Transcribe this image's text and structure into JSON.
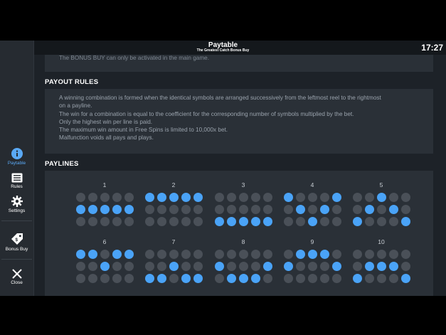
{
  "header": {
    "title": "Paytable",
    "subtitle": "The Greatest Catch Bonus Buy",
    "clock": "17:27"
  },
  "sidebar": {
    "items": [
      {
        "label": "Paytable",
        "icon": "info-icon",
        "active": true
      },
      {
        "label": "Rules",
        "icon": "list-icon"
      },
      {
        "label": "Settings",
        "icon": "gear-icon"
      },
      {
        "label": "Bonus Buy",
        "icon": "tag-icon"
      },
      {
        "label": "Close",
        "icon": "close-icon"
      }
    ]
  },
  "bonus_note": "The BONUS BUY can only be activated in the main game.",
  "payout": {
    "heading": "PAYOUT RULES",
    "lines": [
      "A winning combination is formed when the identical symbols are arranged successively from the leftmost reel to the rightmost",
      "on a payline.",
      "The win for a combination is equal to the coefficient for the corresponding number of symbols multiplied by the bet.",
      "Only the highest win per line is paid.",
      "The maximum win amount in Free Spins is limited to 10,000x bet.",
      "Malfunction voids all pays and plays."
    ]
  },
  "paylines": {
    "heading": "PAYLINES",
    "active_color": "#4aa3f7",
    "inactive_color": "#4a5058",
    "items": [
      {
        "number": "1",
        "rows": [
          1,
          1,
          1,
          1,
          1
        ]
      },
      {
        "number": "2",
        "rows": [
          0,
          0,
          0,
          0,
          0
        ]
      },
      {
        "number": "3",
        "rows": [
          2,
          2,
          2,
          2,
          2
        ]
      },
      {
        "number": "4",
        "rows": [
          0,
          1,
          2,
          1,
          0
        ]
      },
      {
        "number": "5",
        "rows": [
          2,
          1,
          0,
          1,
          2
        ]
      },
      {
        "number": "6",
        "rows": [
          0,
          0,
          1,
          0,
          0
        ]
      },
      {
        "number": "7",
        "rows": [
          2,
          2,
          1,
          2,
          2
        ]
      },
      {
        "number": "8",
        "rows": [
          1,
          2,
          2,
          2,
          1
        ]
      },
      {
        "number": "9",
        "rows": [
          1,
          0,
          0,
          0,
          1
        ]
      },
      {
        "number": "10",
        "rows": [
          2,
          1,
          1,
          1,
          2
        ]
      }
    ]
  }
}
